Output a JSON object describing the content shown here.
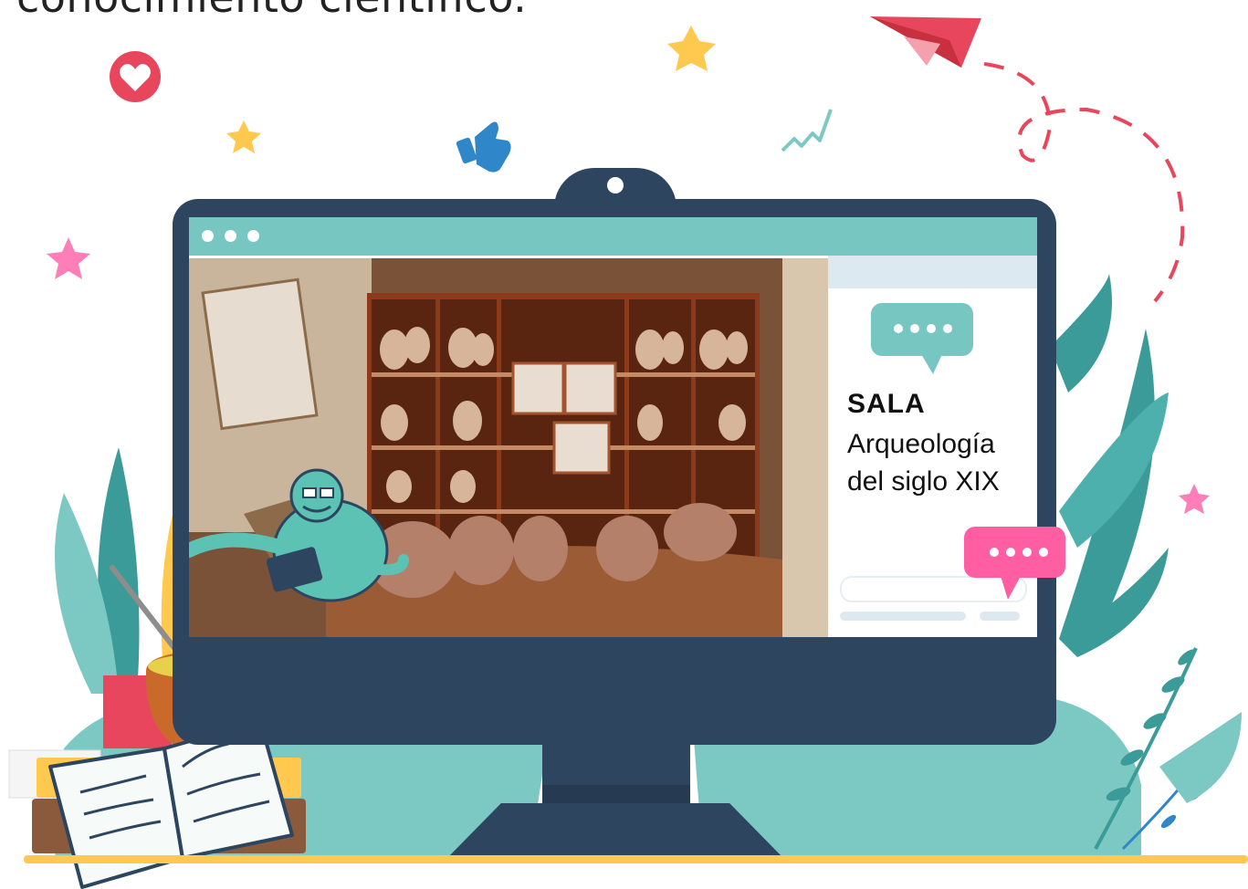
{
  "heading": {
    "text": "conocimiento científico."
  },
  "screen": {
    "browser_dots": 3,
    "photo_subject": "Sala de museo con vitrinas de madera llenas de vasijas arqueológicas",
    "panel": {
      "title": "SALA",
      "subtitle": "Arqueología del siglo XIX"
    }
  },
  "colors": {
    "monitor": "#2e4560",
    "browser_bar": "#77c6c2",
    "teal": "#3a9b98",
    "light_teal": "#7cc9c4",
    "pink": "#ff5fa2",
    "yellow": "#ffc84e",
    "red": "#e8465c",
    "blue": "#2f86c8"
  },
  "icons": [
    "heart-icon",
    "thumbs-up-icon",
    "star-icon",
    "paper-plane-icon",
    "chat-bubble-icon",
    "zigzag-icon"
  ]
}
